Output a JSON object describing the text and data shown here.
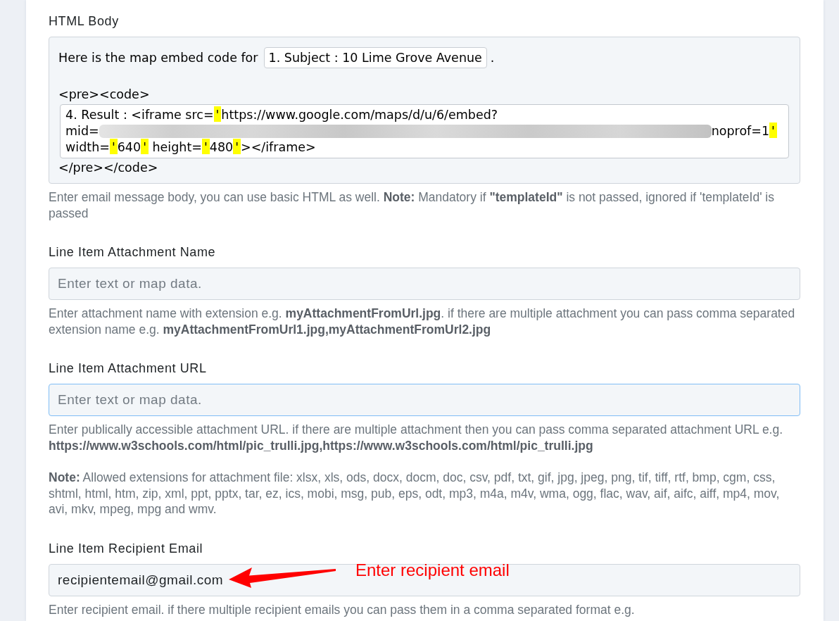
{
  "html_body": {
    "label": "HTML Body",
    "intro": "Here is the map embed code for",
    "token": "1. Subject : 10 Lime Grove Avenue",
    "intro_end": ".",
    "open_tag": "<pre><code>",
    "code_lines": [
      {
        "segments": [
          {
            "kind": "text",
            "text": "4. Result : <iframe src=",
            "highlighted": false
          },
          {
            "kind": "text",
            "text": "'",
            "highlighted": true
          },
          {
            "kind": "text",
            "text": "https://www.google.com/maps/d/u/6/embed?",
            "highlighted": false
          }
        ]
      },
      {
        "segments": [
          {
            "kind": "text",
            "text": "mid=",
            "highlighted": false
          },
          {
            "kind": "redacted"
          },
          {
            "kind": "text",
            "text": "noprof=1",
            "highlighted": false
          },
          {
            "kind": "text",
            "text": "'",
            "highlighted": true
          }
        ]
      },
      {
        "segments": [
          {
            "kind": "text",
            "text": "width=",
            "highlighted": false
          },
          {
            "kind": "text",
            "text": "'",
            "highlighted": true
          },
          {
            "kind": "text",
            "text": "640",
            "highlighted": false
          },
          {
            "kind": "text",
            "text": "'",
            "highlighted": true
          },
          {
            "kind": "text",
            "text": " height=",
            "highlighted": false
          },
          {
            "kind": "text",
            "text": "'",
            "highlighted": true
          },
          {
            "kind": "text",
            "text": "480",
            "highlighted": false
          },
          {
            "kind": "text",
            "text": "'",
            "highlighted": true
          },
          {
            "kind": "text",
            "text": "></iframe>",
            "highlighted": false
          }
        ]
      }
    ],
    "close_tag": "</pre></code>",
    "help": [
      "Enter email message body, you can use basic HTML as well. **Note:** Mandatory if **\"templateId\"** is not passed, ignored if 'templateId' is passed"
    ]
  },
  "fields": [
    {
      "label": "Line Item Attachment Name",
      "placeholder": "Enter text or map data.",
      "focused": false,
      "help": [
        "Enter attachment name with extension e.g. **myAttachmentFromUrl.jpg**. if there are multiple attachment you can pass comma separated extension name e.g. **myAttachmentFromUrl1.jpg,myAttachmentFromUrl2.jpg**"
      ]
    },
    {
      "label": "Line Item Attachment URL",
      "placeholder": "Enter text or map data.",
      "focused": true,
      "help": [
        "Enter publically accessible attachment URL. if there are multiple attachment then you can pass comma separated attachment URL e.g. **https://www.w3schools.com/html/pic_trulli.jpg,https://www.w3schools.com/html/pic_trulli.jpg**",
        "**Note:** Allowed extensions for attachment file: xlsx, xls, ods, docx, docm, doc, csv, pdf, txt, gif, jpg, jpeg, png, tif, tiff, rtf, bmp, cgm, css, shtml, html, htm, zip, xml, ppt, pptx, tar, ez, ics, mobi, msg, pub, eps, odt, mp3, m4a, m4v, wma, ogg, flac, wav, aif, aifc, aiff, mp4, mov, avi, mkv, mpeg, mpg and wmv."
      ]
    },
    {
      "label": "Line Item Recipient Email",
      "value": "recipientemail@gmail.com",
      "focused": false,
      "annotation": "Enter recipient email",
      "help": [
        "Enter recipient email. if there multiple recipient emails you can pass them in a comma separated format e.g."
      ]
    }
  ]
}
